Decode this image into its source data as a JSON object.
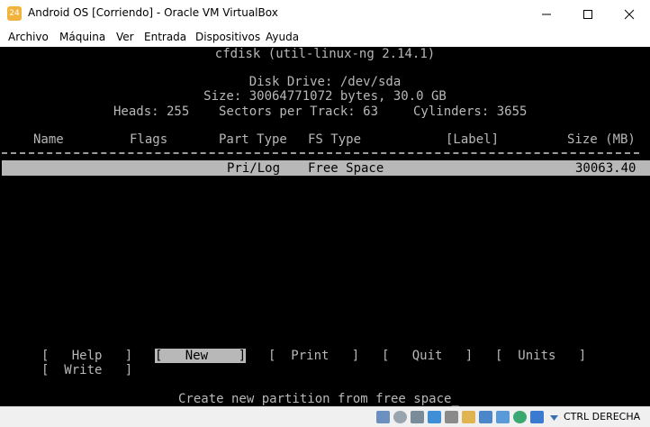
{
  "window": {
    "title": "Android OS [Corriendo] - Oracle VM VirtualBox",
    "icon_name": "virtualbox-app-icon",
    "icon_text": "24"
  },
  "menu": [
    {
      "label": "Archivo"
    },
    {
      "label": "Máquina"
    },
    {
      "label": "Ver"
    },
    {
      "label": "Entrada"
    },
    {
      "label": "Dispositivos"
    },
    {
      "label": "Ayuda"
    }
  ],
  "console": {
    "program": "cfdisk (util-linux-ng 2.14.1)",
    "disk_drive": "Disk Drive: /dev/sda",
    "size": "Size: 30064771072 bytes, 30.0 GB",
    "geometry": {
      "heads": "Heads: 255",
      "sectors": "Sectors per Track: 63",
      "cylinders": "Cylinders: 3655"
    },
    "columns": [
      "Name",
      "Flags",
      "Part Type",
      "FS Type",
      "[Label]",
      "Size (MB)"
    ],
    "rows": [
      {
        "part_type": "Pri/Log",
        "fs_type": "Free Space",
        "size_mb": "30063.40"
      }
    ],
    "options": [
      {
        "label": "[   Help   ]",
        "selected": false
      },
      {
        "label": "[   New    ]",
        "selected": true
      },
      {
        "label": "[  Print   ]",
        "selected": false
      },
      {
        "label": "[   Quit   ]",
        "selected": false
      },
      {
        "label": "[  Units   ]",
        "selected": false
      },
      {
        "label": "[  Write   ]",
        "selected": false
      }
    ],
    "hint": "Create new partition from free space",
    "cursor": "_"
  },
  "statusbar": {
    "host_key": "CTRL DERECHA",
    "icons": [
      "hard-disk-icon",
      "optical-drive-icon",
      "audio-icon",
      "network-icon",
      "usb-icon",
      "shared-folders-icon",
      "display-icon",
      "video-capture-icon",
      "recording-icon",
      "cpu-icon",
      "arrow-down-icon"
    ]
  },
  "colors": {
    "console_bg": "#000000",
    "console_fg": "#b8b8b8",
    "highlight_bg": "#b8b8b8",
    "highlight_fg": "#000000",
    "window_bg": "#ffffff",
    "statusbar_bg": "#f0f0f0"
  }
}
